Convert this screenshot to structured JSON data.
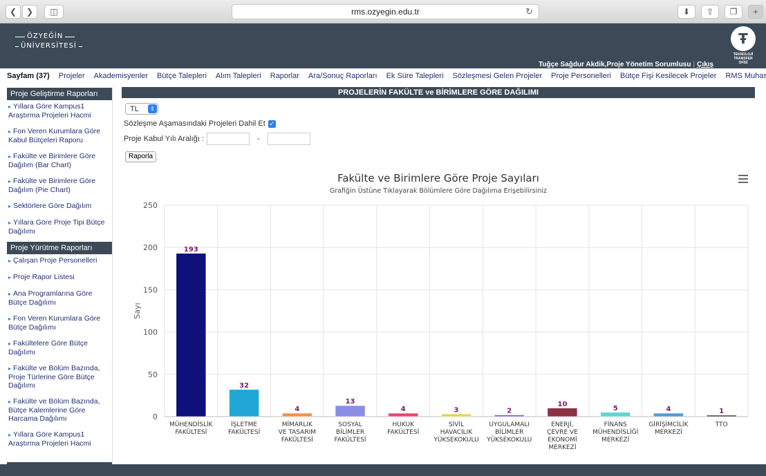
{
  "browser": {
    "url": "rms.ozyegin.edu.tr",
    "icons": [
      "back-icon",
      "forward-icon",
      "sidebar-icon",
      "reload-icon",
      "download-icon",
      "share-icon",
      "tabs-icon",
      "new-tab-icon"
    ]
  },
  "header": {
    "logo_line1": "ÖZYEĞİN",
    "logo_line2": "ÜNİVERSİTESİ",
    "tto_line1": "TEKNOLOJİ",
    "tto_line2": "TRANSFER",
    "tto_line3": "OFİSİ",
    "user": "Tuğçe Sağdur Akdik,Proje Yönetim Sorumlusu",
    "separator": "|",
    "logout": "Çıkış"
  },
  "nav": [
    "Sayfam (37)",
    "Projeler",
    "Akademisyenler",
    "Bütçe Talepleri",
    "Alım Talepleri",
    "Raporlar",
    "Ara/Sonuç Raporları",
    "Ek Süre Talepleri",
    "Sözleşmesi Gelen Projeler",
    "Proje Personelleri",
    "Bütçe Fişi Kesilecek Projeler",
    "RMS Muhasebe"
  ],
  "sidebar": {
    "section1_title": "Proje Geliştirme Raporları",
    "section1_items": [
      "Yıllara Göre Kampus1 Araştırma Projeleri Hacmi",
      "Fon Veren Kurumlara Göre Kabul Bütçeleri Raporu",
      "Fakülte ve Birimlere Göre Dağılım (Bar Chart)",
      "Fakülte ve Birimlere Göre Dağılım (Pie Chart)",
      "Sektörlere Göre Dağılım",
      "Yıllara Göre Proje Tipi Bütçe Dağılımı"
    ],
    "section2_title": "Proje Yürütme Raporları",
    "section2_items": [
      "Çalışan Proje Personelleri",
      "Proje Rapor Listesi",
      "Ana Programlarına Göre Bütçe Dağılımı",
      "Fon Veren Kurumlara Göre Bütçe Dağılımı",
      "Fakültelere Göre Bütçe Dağılımı",
      "Fakülte ve Bölüm Bazında, Proje Türlerine Göre Bütçe Dağılımı",
      "Fakülte ve Bölüm Bazında, Bütçe Kalemlerine Göre Harcama Dağılımı",
      "Yıllara Göre Kampus1 Araştırma Projeleri Hacmi"
    ]
  },
  "main": {
    "title": "PROJELERİN FAKÜLTE ve BİRİMLERE GÖRE DAĞILIMI",
    "currency_selected": "TL",
    "include_label": "Sözleşme Aşamasındaki Projeleri Dahil Et",
    "include_checked": true,
    "year_range_label": "Proje Kabul Yılı Aralığı :",
    "year_from": "",
    "year_to": "",
    "range_dash": "-",
    "report_button": "Raporla"
  },
  "chart_data": {
    "type": "bar",
    "title": "Fakülte ve Birimlere Göre Proje Sayıları",
    "subtitle": "Grafiğin Üstüne Tıklayarak Bölümlere Göre Dağılıma Erişebilirsiniz",
    "ylabel": "Sayı",
    "ylim": [
      0,
      250
    ],
    "yticks": [
      0,
      50,
      100,
      150,
      200,
      250
    ],
    "grid": true,
    "categories": [
      [
        "MÜHENDİSLİK",
        "FAKÜLTESİ"
      ],
      [
        "İŞLETME",
        "FAKÜLTESİ"
      ],
      [
        "MİMARLIK",
        "VE TASARIM",
        "FAKÜLTESİ"
      ],
      [
        "SOSYAL",
        "BİLİMLER",
        "FAKÜLTESİ"
      ],
      [
        "HUKUK",
        "FAKÜLTESİ"
      ],
      [
        "SİVİL",
        "HAVACILIK",
        "YÜKSEKOKULU"
      ],
      [
        "UYGULAMALI",
        "BİLİMLER",
        "YÜKSEKOKULU"
      ],
      [
        "ENERJİ,",
        "ÇEVRE VE",
        "EKONOMİ",
        "MERKEZİ"
      ],
      [
        "FİNANS",
        "MÜHENDİSLİĞİ",
        "MERKEZİ"
      ],
      [
        "GİRİŞİMCİLİK",
        "MERKEZİ"
      ],
      [
        "TTO"
      ]
    ],
    "values": [
      193,
      32,
      4,
      13,
      4,
      3,
      2,
      10,
      5,
      4,
      1
    ],
    "colors": [
      "#10107a",
      "#21a7d6",
      "#f0914a",
      "#8a8ee6",
      "#e8466e",
      "#e4d24c",
      "#7272d8",
      "#8b3344",
      "#5ed6d0",
      "#5598d8",
      "#444444"
    ],
    "label_color": "#7a1a6a"
  }
}
